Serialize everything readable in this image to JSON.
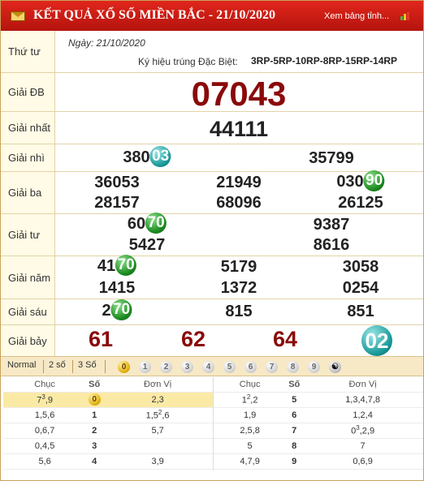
{
  "header": {
    "title": "KẾT QUẢ XỔ SỐ MIỀN BẮC - 21/10/2020",
    "link": "Xem bảng tỉnh..."
  },
  "info": {
    "weekday": "Thứ tư",
    "date": "Ngày: 21/10/2020",
    "code_label": "Ký hiệu trúng Đặc Biệt:",
    "code_value": "3RP-5RP-10RP-8RP-15RP-14RP"
  },
  "prizes": {
    "db": {
      "label": "Giải ĐB",
      "value": "07043"
    },
    "nhat": {
      "label": "Giải nhất",
      "value": "44111"
    },
    "nhi": {
      "label": "Giải nhì",
      "values": [
        {
          "pre": "380",
          "tail": "03"
        },
        {
          "pre": "35799",
          "tail": ""
        }
      ]
    },
    "ba": {
      "label": "Giải ba",
      "values": [
        {
          "pre": "36053",
          "tail": ""
        },
        {
          "pre": "21949",
          "tail": ""
        },
        {
          "pre": "030",
          "tail": "90"
        },
        {
          "pre": "28157",
          "tail": ""
        },
        {
          "pre": "68096",
          "tail": ""
        },
        {
          "pre": "26125",
          "tail": ""
        }
      ]
    },
    "tu": {
      "label": "Giải tư",
      "values": [
        {
          "pre": "60",
          "tail": "70"
        },
        {
          "pre": "9387",
          "tail": ""
        },
        {
          "pre": "5427",
          "tail": ""
        },
        {
          "pre": "8616",
          "tail": ""
        }
      ]
    },
    "nam": {
      "label": "Giải năm",
      "values": [
        {
          "pre": "41",
          "tail": "70"
        },
        {
          "pre": "5179",
          "tail": ""
        },
        {
          "pre": "3058",
          "tail": ""
        },
        {
          "pre": "1415",
          "tail": ""
        },
        {
          "pre": "1372",
          "tail": ""
        },
        {
          "pre": "0254",
          "tail": ""
        }
      ]
    },
    "sau": {
      "label": "Giải sáu",
      "values": [
        {
          "pre": "2",
          "tail": "70"
        },
        {
          "pre": "815",
          "tail": ""
        },
        {
          "pre": "851",
          "tail": ""
        }
      ]
    },
    "bay": {
      "label": "Giải bảy",
      "values": [
        "61",
        "62",
        "64",
        "02"
      ]
    }
  },
  "tabs": {
    "normal": "Normal",
    "two": "2 số",
    "three": "3 Số",
    "digits": [
      "0",
      "1",
      "2",
      "3",
      "4",
      "5",
      "6",
      "7",
      "8",
      "9"
    ]
  },
  "loto": {
    "headers": {
      "chuc": "Chục",
      "so": "Số",
      "donvi": "Đơn Vị"
    },
    "left": [
      {
        "chuc": "7",
        "chuc_sup": "3",
        "chuc_rest": ",9",
        "so": "0",
        "donvi": "2,3",
        "donvi_sup": "",
        "donvi_rest": ""
      },
      {
        "chuc": "1,5,6",
        "chuc_sup": "",
        "chuc_rest": "",
        "so": "1",
        "donvi": "1,5",
        "donvi_sup": "2",
        "donvi_rest": ",6"
      },
      {
        "chuc": "0,6,7",
        "chuc_sup": "",
        "chuc_rest": "",
        "so": "2",
        "donvi": "5,7",
        "donvi_sup": "",
        "donvi_rest": ""
      },
      {
        "chuc": "0,4,5",
        "chuc_sup": "",
        "chuc_rest": "",
        "so": "3",
        "donvi": "",
        "donvi_sup": "",
        "donvi_rest": ""
      },
      {
        "chuc": "5,6",
        "chuc_sup": "",
        "chuc_rest": "",
        "so": "4",
        "donvi": "3,9",
        "donvi_sup": "",
        "donvi_rest": ""
      }
    ],
    "right": [
      {
        "chuc": "1",
        "chuc_sup": "2",
        "chuc_rest": ",2",
        "so": "5",
        "donvi": "1,3,4,7,8",
        "donvi_sup": "",
        "donvi_rest": ""
      },
      {
        "chuc": "1,9",
        "chuc_sup": "",
        "chuc_rest": "",
        "so": "6",
        "donvi": "1,2,4",
        "donvi_sup": "",
        "donvi_rest": ""
      },
      {
        "chuc": "2,5,8",
        "chuc_sup": "",
        "chuc_rest": "",
        "so": "7",
        "donvi": "0",
        "donvi_sup": "3",
        "donvi_rest": ",2,9"
      },
      {
        "chuc": "5",
        "chuc_sup": "",
        "chuc_rest": "",
        "so": "8",
        "donvi": "7",
        "donvi_sup": "",
        "donvi_rest": ""
      },
      {
        "chuc": "4,7,9",
        "chuc_sup": "",
        "chuc_rest": "",
        "so": "9",
        "donvi": "0,6,9",
        "donvi_sup": "",
        "donvi_rest": ""
      }
    ]
  },
  "colors": {
    "header": "#c41a12",
    "special": "#8a0a0a",
    "ball_green": "#1a8a1f",
    "ball_teal": "#1a9a9a",
    "highlight": "#fbeaa6"
  }
}
